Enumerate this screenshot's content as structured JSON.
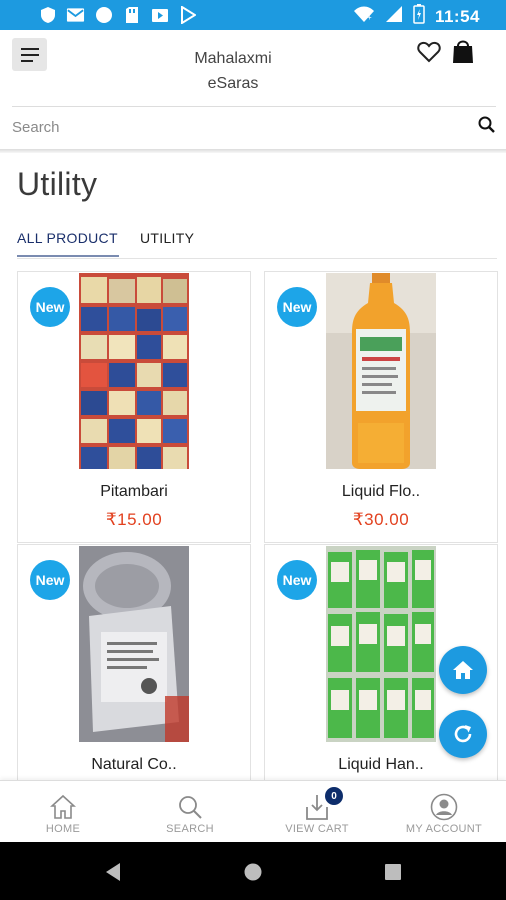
{
  "status_bar": {
    "time": "11:54",
    "left_icons": [
      "shield-icon",
      "gmail-icon",
      "circle-icon",
      "sd-card-icon",
      "play-store-icon",
      "play-icon"
    ],
    "right_icons": [
      "wifi-icon",
      "signal-icon",
      "battery-icon"
    ]
  },
  "header": {
    "store_name_line1": "Mahalaxmi",
    "store_name_line2": "eSaras",
    "menu_icon": "hamburger-icon",
    "wishlist_icon": "heart-icon",
    "bag_icon": "shopping-bag-icon"
  },
  "search": {
    "placeholder": "Search",
    "icon": "search-icon"
  },
  "page": {
    "title": "Utility"
  },
  "tabs": [
    {
      "label": "ALL PRODUCT",
      "active": true
    },
    {
      "label": "UTILITY",
      "active": false
    }
  ],
  "products": [
    {
      "name": "Pitambari",
      "price": "₹15.00",
      "badge": "New",
      "image": "pitambari-packets-image"
    },
    {
      "name": "Liquid Flo..",
      "price": "₹30.00",
      "badge": "New",
      "image": "floor-cleaner-bottle-image"
    },
    {
      "name": "Natural Co..",
      "price": "",
      "badge": "New",
      "image": "natural-product-bag-image"
    },
    {
      "name": "Liquid Han..",
      "price": "",
      "badge": "New",
      "image": "hand-wash-bottles-image"
    }
  ],
  "fabs": {
    "home_icon": "home-icon",
    "refresh_icon": "refresh-icon"
  },
  "bottom_nav": [
    {
      "label": "HOME",
      "icon": "home-icon"
    },
    {
      "label": "SEARCH",
      "icon": "search-icon"
    },
    {
      "label": "VIEW CART",
      "icon": "cart-download-icon",
      "badge": "0"
    },
    {
      "label": "MY ACCOUNT",
      "icon": "account-icon"
    }
  ],
  "system_nav": [
    "back-icon",
    "home-circle-icon",
    "recents-icon"
  ],
  "colors": {
    "status_bar": "#1d9ae0",
    "accent": "#1d9ae0",
    "new_badge": "#1da5e8",
    "price": "#e2411f",
    "active_tab": "#1a2f6b",
    "cart_badge": "#0d2d6b"
  }
}
